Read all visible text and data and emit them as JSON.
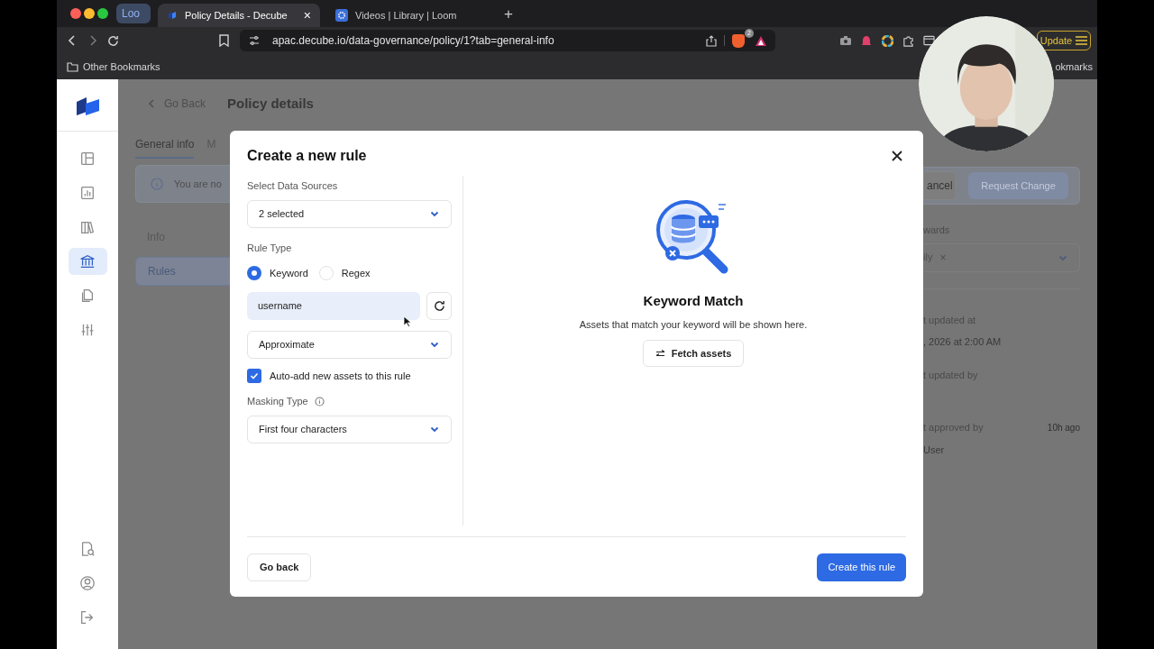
{
  "browser": {
    "tabs": [
      {
        "kind": "group",
        "label": "Loo",
        "selected": false
      },
      {
        "kind": "tab",
        "label": "Policy Details - Decube",
        "selected": true,
        "close": "×"
      },
      {
        "kind": "tab",
        "label": "Videos | Library | Loom",
        "selected": false
      }
    ],
    "new_tab": "+",
    "address": "apac.decube.io/data-governance/policy/1?tab=general-info",
    "extension_badge": "2",
    "update_button": "Update",
    "bookmarks": [
      "Other Bookmarks",
      "okmarks"
    ]
  },
  "sidebar": {
    "items": [
      {
        "selected": false
      },
      {
        "selected": false
      },
      {
        "selected": false
      },
      {
        "selected": true
      },
      {
        "selected": false
      },
      {
        "selected": false
      }
    ],
    "bottom_items": [
      {
        "selected": false
      },
      {
        "selected": false
      },
      {
        "selected": false
      }
    ]
  },
  "page": {
    "back_link": "Go Back",
    "title": "Policy details",
    "tabs": [
      {
        "label": "General info",
        "selected": true
      },
      {
        "label": "M",
        "selected": false
      }
    ],
    "notice": "You are no",
    "cancel_button": "ancel",
    "request_button": "Request Change",
    "sections": [
      {
        "label": "Info",
        "selected": false
      },
      {
        "label": "Rules",
        "selected": true
      }
    ],
    "right": {
      "field_label": "wards",
      "tag": "ily",
      "tag_remove": "×",
      "updated_at_label": "t updated at",
      "updated_at": ", 2026 at 2:00 AM",
      "updated_by_label": "t updated by",
      "approved_by_label": "t approved by",
      "approved_time": "10h ago",
      "approved_by": "User"
    }
  },
  "modal": {
    "title": "Create a new rule",
    "data_sources": {
      "label": "Select Data Sources",
      "value": "2 selected"
    },
    "rule_type": {
      "label": "Rule Type",
      "options": [
        {
          "label": "Keyword",
          "selected": true
        },
        {
          "label": "Regex",
          "selected": false
        }
      ]
    },
    "keyword": {
      "value": "username"
    },
    "match": {
      "value": "Approximate"
    },
    "auto_add": {
      "label": "Auto-add new assets to this rule",
      "checked": true
    },
    "masking": {
      "label": "Masking Type",
      "value": "First four characters"
    },
    "preview": {
      "title": "Keyword Match",
      "description": "Assets that match your keyword will be shown here.",
      "button": "Fetch assets"
    },
    "back_button": "Go back",
    "create_button": "Create this rule"
  }
}
